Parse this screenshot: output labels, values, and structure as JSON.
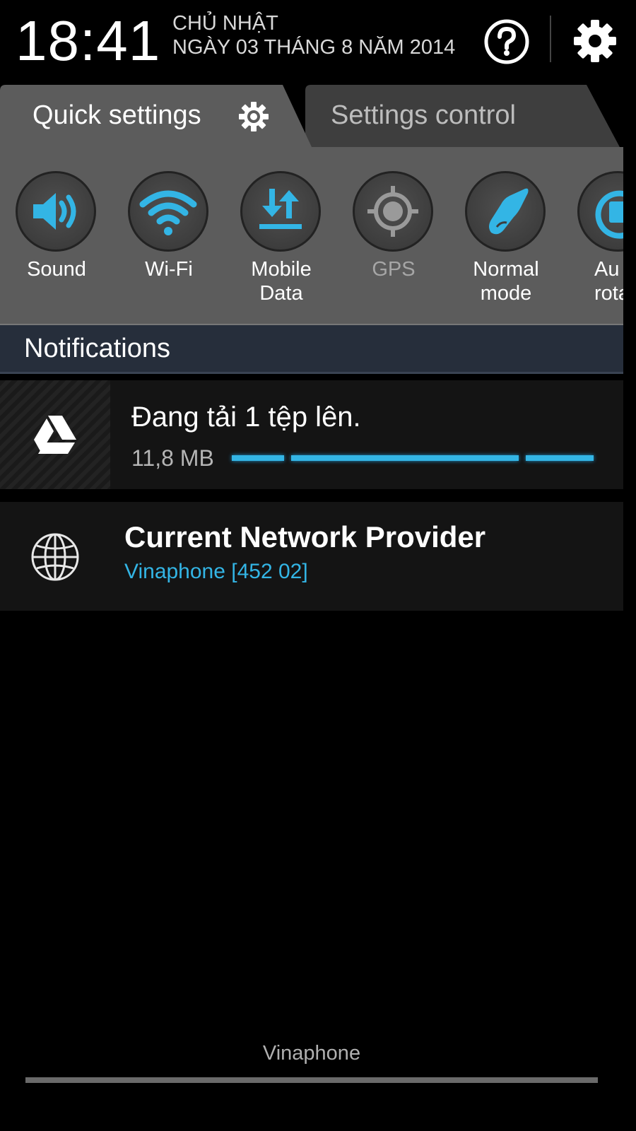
{
  "header": {
    "time": "18:41",
    "day": "CHỦ NHẬT",
    "date": "NGÀY 03 THÁNG 8 NĂM 2014",
    "icons": [
      "help-icon",
      "gear-icon"
    ]
  },
  "tabs": [
    {
      "label": "Quick settings",
      "active": true,
      "icon": "gear-icon"
    },
    {
      "label": "Settings control",
      "active": false
    }
  ],
  "quick_settings": [
    {
      "label": "Sound",
      "icon": "speaker-icon",
      "state": "on"
    },
    {
      "label": "Wi-Fi",
      "icon": "wifi-icon",
      "state": "on"
    },
    {
      "label": "Mobile Data",
      "line1": "Mobile",
      "line2": "Data",
      "icon": "data-transfer-icon",
      "state": "on"
    },
    {
      "label": "GPS",
      "icon": "gps-icon",
      "state": "off"
    },
    {
      "label": "Normal mode",
      "line1": "Normal",
      "line2": "mode",
      "icon": "hand-icon",
      "state": "on"
    },
    {
      "label": "Auto rotate",
      "line1": "Au",
      "line2": "rota",
      "icon": "rotate-icon",
      "state": "on"
    }
  ],
  "notifications_header": "Notifications",
  "notifications": [
    {
      "icon": "google-drive-icon",
      "title": "Đang tải 1 tệp lên.",
      "size": "11,8 MB",
      "progress": "indeterminate"
    },
    {
      "icon": "globe-icon",
      "title": "Current Network Provider",
      "subtitle": "Vinaphone [452 02]"
    }
  ],
  "footer": {
    "carrier": "Vinaphone"
  },
  "colors": {
    "accent": "#33b5e5",
    "panel": "#5c5c5c",
    "notif_header": "#262e3b",
    "background": "#000000"
  }
}
